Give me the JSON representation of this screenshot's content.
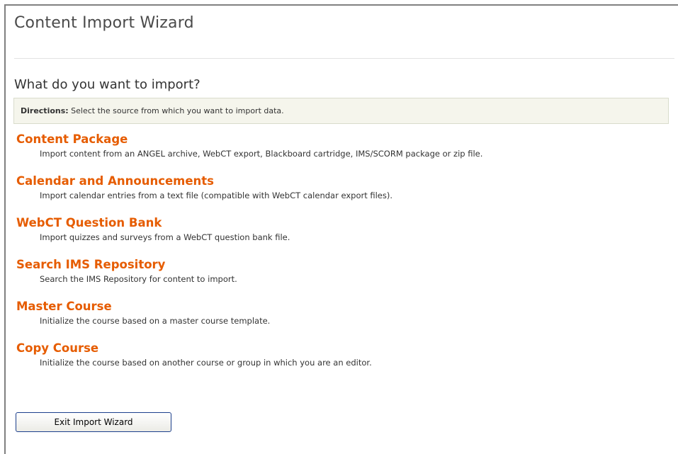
{
  "wizard": {
    "title": "Content Import Wizard",
    "heading": "What do you want to import?",
    "directions_label": "Directions:",
    "directions_text": " Select the source from which you want to import data."
  },
  "options": [
    {
      "label": "Content Package",
      "description": "Import content from an ANGEL archive, WebCT export, Blackboard cartridge, IMS/SCORM package or zip file."
    },
    {
      "label": "Calendar and Announcements",
      "description": "Import calendar entries from a text file (compatible with WebCT calendar export files)."
    },
    {
      "label": "WebCT Question Bank",
      "description": "Import quizzes and surveys from a WebCT question bank file."
    },
    {
      "label": "Search IMS Repository",
      "description": "Search the IMS Repository for content to import."
    },
    {
      "label": "Master Course",
      "description": "Initialize the course based on a master course template."
    },
    {
      "label": "Copy Course",
      "description": "Initialize the course based on another course or group in which you are an editor."
    }
  ],
  "footer": {
    "exit_label": "Exit Import Wizard"
  },
  "colors": {
    "link": "#e65c00",
    "directions_bg": "#f5f5ec",
    "button_border": "#1c3f8c"
  }
}
